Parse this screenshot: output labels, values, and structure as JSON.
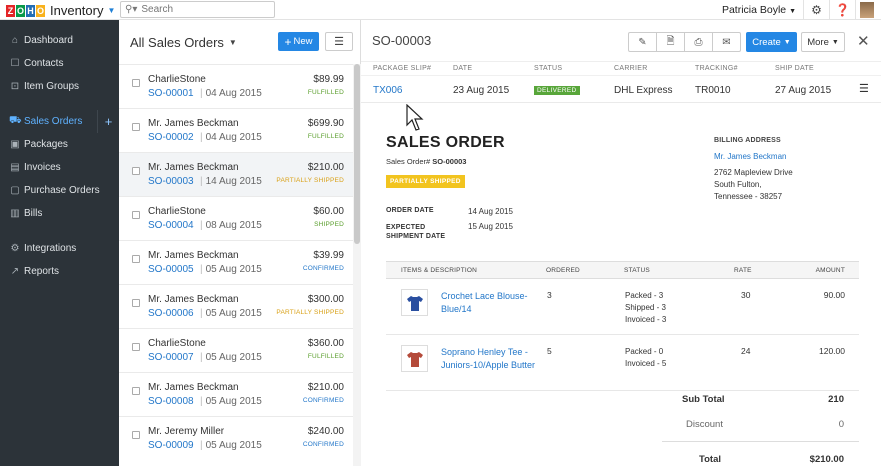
{
  "app": {
    "name": "Inventory",
    "brand_letters": [
      "Z",
      "O",
      "H",
      "O"
    ],
    "brand_colors": [
      "#e42527",
      "#089949",
      "#226db4",
      "#f9b21d"
    ],
    "search_placeholder": "Search",
    "user_name": "Patricia Boyle"
  },
  "sidebar": {
    "items": [
      {
        "label": "Dashboard",
        "icon": "home-icon"
      },
      {
        "label": "Contacts",
        "icon": "contacts-icon"
      },
      {
        "label": "Item Groups",
        "icon": "item-groups-icon"
      },
      {
        "label": "Sales Orders",
        "icon": "cart-icon",
        "active": true
      },
      {
        "label": "Packages",
        "icon": "package-icon"
      },
      {
        "label": "Invoices",
        "icon": "invoice-icon"
      },
      {
        "label": "Purchase Orders",
        "icon": "purchase-icon"
      },
      {
        "label": "Bills",
        "icon": "bill-icon"
      },
      {
        "label": "Integrations",
        "icon": "integrations-icon"
      },
      {
        "label": "Reports",
        "icon": "reports-icon"
      }
    ]
  },
  "list": {
    "title": "All Sales Orders",
    "new_label": "New",
    "orders": [
      {
        "customer": "CharlieStone",
        "number": "SO-00001",
        "date": "04 Aug 2015",
        "amount": "$89.99",
        "status": "FULFILLED",
        "status_class": "st-fulfilled"
      },
      {
        "customer": "Mr. James Beckman",
        "number": "SO-00002",
        "date": "04 Aug 2015",
        "amount": "$699.90",
        "status": "FULFILLED",
        "status_class": "st-fulfilled"
      },
      {
        "customer": "Mr. James Beckman",
        "number": "SO-00003",
        "date": "14 Aug 2015",
        "amount": "$210.00",
        "status": "PARTIALLY SHIPPED",
        "status_class": "st-partial",
        "selected": true
      },
      {
        "customer": "CharlieStone",
        "number": "SO-00004",
        "date": "08 Aug 2015",
        "amount": "$60.00",
        "status": "SHIPPED",
        "status_class": "st-shipped"
      },
      {
        "customer": "Mr. James Beckman",
        "number": "SO-00005",
        "date": "05 Aug 2015",
        "amount": "$39.99",
        "status": "CONFIRMED",
        "status_class": "st-confirmed"
      },
      {
        "customer": "Mr. James Beckman",
        "number": "SO-00006",
        "date": "05 Aug 2015",
        "amount": "$300.00",
        "status": "PARTIALLY SHIPPED",
        "status_class": "st-partial"
      },
      {
        "customer": "CharlieStone",
        "number": "SO-00007",
        "date": "05 Aug 2015",
        "amount": "$360.00",
        "status": "FULFILLED",
        "status_class": "st-fulfilled"
      },
      {
        "customer": "Mr. James Beckman",
        "number": "SO-00008",
        "date": "05 Aug 2015",
        "amount": "$210.00",
        "status": "CONFIRMED",
        "status_class": "st-confirmed"
      },
      {
        "customer": "Mr. Jeremy Miller",
        "number": "SO-00009",
        "date": "05 Aug 2015",
        "amount": "$240.00",
        "status": "CONFIRMED",
        "status_class": "st-confirmed"
      }
    ]
  },
  "detail": {
    "title": "SO-00003",
    "create_label": "Create",
    "more_label": "More",
    "package": {
      "headers": [
        "PACKAGE SLIP#",
        "DATE",
        "STATUS",
        "CARRIER",
        "TRACKING#",
        "SHIP DATE"
      ],
      "slip": "TX006",
      "date": "23 Aug 2015",
      "status": "DELIVERED",
      "carrier": "DHL Express",
      "tracking": "TR0010",
      "ship_date": "27 Aug 2015"
    },
    "doc": {
      "heading": "SALES ORDER",
      "order_label": "Sales Order#",
      "order_number": "SO-00003",
      "status_badge": "PARTIALLY SHIPPED",
      "order_date_label": "ORDER DATE",
      "order_date": "14 Aug 2015",
      "expected_label_1": "EXPECTED",
      "expected_label_2": "SHIPMENT DATE",
      "expected_date": "15 Aug 2015",
      "billing_label": "BILLING ADDRESS",
      "billing_name": "Mr. James Beckman",
      "billing_lines": [
        "2762 Mapleview Drive",
        "South Fulton,",
        "Tennessee - 38257"
      ],
      "item_headers": [
        "ITEMS & DESCRIPTION",
        "ORDERED",
        "STATUS",
        "RATE",
        "AMOUNT"
      ],
      "items": [
        {
          "name": "Crochet Lace Blouse-Blue/14",
          "ordered": "3",
          "status_lines": [
            "Packed - 3",
            "Shipped - 3",
            "Invoiced - 3"
          ],
          "rate": "30",
          "amount": "90.00",
          "color": "#2a4fa0"
        },
        {
          "name": "Soprano Henley Tee - Juniors-10/Apple Butter",
          "ordered": "5",
          "status_lines": [
            "Packed - 0",
            "Invoiced - 5"
          ],
          "rate": "24",
          "amount": "120.00",
          "color": "#b44a3a"
        }
      ],
      "sub_total_label": "Sub Total",
      "sub_total": "210",
      "discount_label": "Discount",
      "discount": "0",
      "total_label": "Total",
      "total": "$210.00"
    }
  }
}
